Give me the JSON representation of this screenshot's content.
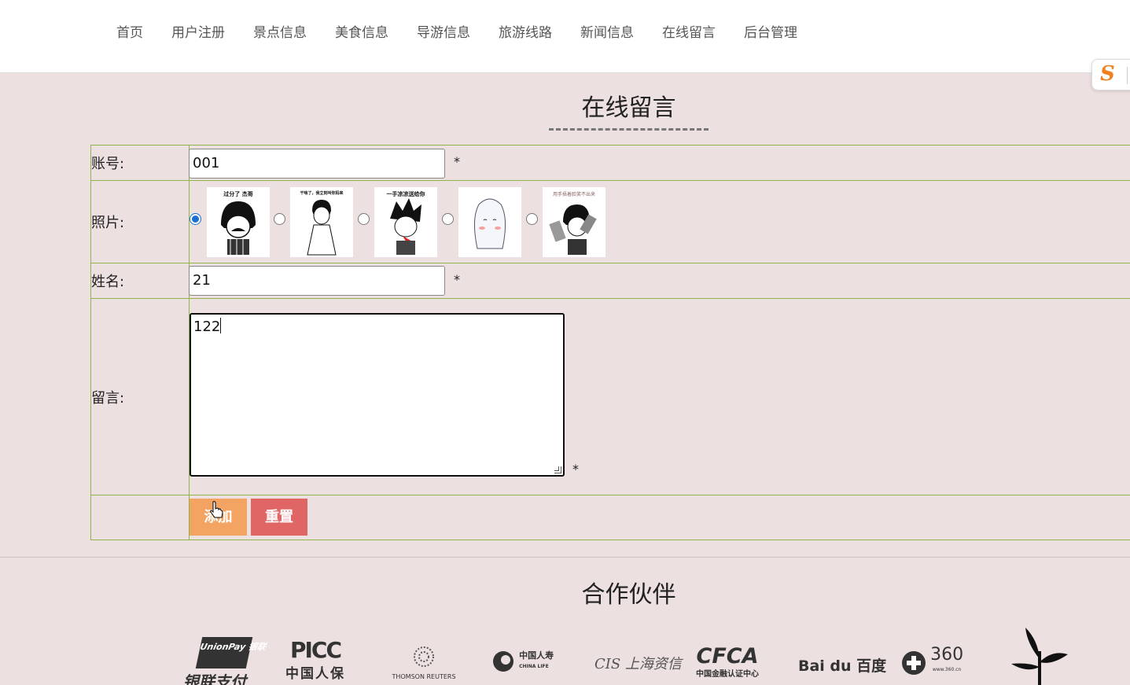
{
  "nav": [
    "首页",
    "用户注册",
    "景点信息",
    "美食信息",
    "导游信息",
    "旅游线路",
    "新闻信息",
    "在线留言",
    "后台管理"
  ],
  "float_badge": "S",
  "page_title": "在线留言",
  "form": {
    "account_label": "账号:",
    "account_value": "001",
    "photo_label": "照片:",
    "photos": [
      {
        "caption": "过分了 杰哥",
        "checked": true
      },
      {
        "caption": "干啥了，我立刻叫你妈来",
        "checked": false
      },
      {
        "caption": "一手凉凉送给你",
        "checked": false
      },
      {
        "caption": "",
        "checked": false
      },
      {
        "caption": "用手捂着脸笑不出来",
        "checked": false
      }
    ],
    "name_label": "姓名:",
    "name_value": "21",
    "message_label": "留言:",
    "message_value": "122",
    "required_mark": "*",
    "add_button": "添加",
    "reset_button": "重置"
  },
  "partners_title": "合作伙伴",
  "partners": [
    {
      "name": "UnionPay 银联",
      "sub": "银联支付"
    },
    {
      "name": "PICC",
      "sub": "中国人保"
    },
    {
      "name": "THOMSON REUTERS",
      "sub": ""
    },
    {
      "name": "中国人寿",
      "sub": "CHINA LIFE"
    },
    {
      "name": "CIS 上海资信",
      "sub": ""
    },
    {
      "name": "CFCA",
      "sub": "中国金融认证中心"
    },
    {
      "name": "Bai du 百度",
      "sub": ""
    },
    {
      "name": "360",
      "sub": "www.360.cn"
    }
  ],
  "colors": {
    "accent_orange": "#f4a462",
    "accent_red": "#e06666",
    "border_green": "#8fb44a",
    "background": "#ede0e0",
    "radio_blue": "#1a6fd0"
  }
}
